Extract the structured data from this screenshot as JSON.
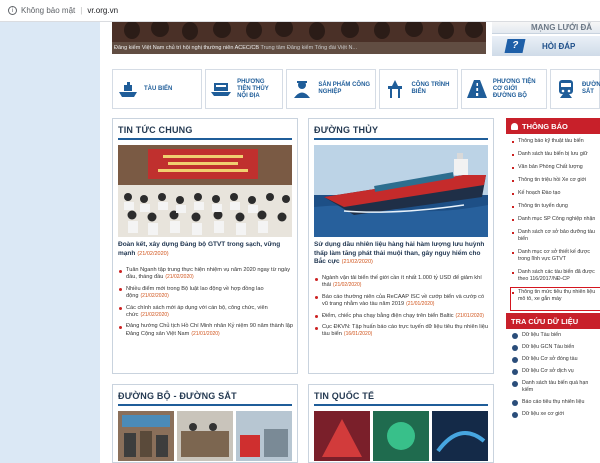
{
  "browser": {
    "security_text": "Không bảo mật",
    "url": "vr.org.vn"
  },
  "banner": {
    "caption": "Đăng kiểm Việt Nam chủ trì hội nghị thường niên ACEC/CB",
    "caption_org": "Trung tâm Đăng kiểm Tổng đài Việt N..."
  },
  "promo": {
    "top_label": "MẠNG LƯỚI ĐĂ",
    "faq_label": "HỎI ĐÁP"
  },
  "categories": [
    {
      "label": "TÀU BIỂN",
      "icon": "ship-icon"
    },
    {
      "label": "PHƯƠNG TIỆN THỦY NỘI ĐỊA",
      "icon": "riverboat-icon"
    },
    {
      "label": "SẢN PHẨM CÔNG NGHIỆP",
      "icon": "worker-icon"
    },
    {
      "label": "CÔNG TRÌNH BIỂN",
      "icon": "offshore-rig-icon"
    },
    {
      "label": "PHƯƠNG TIỆN CƠ GIỚI ĐƯỜNG BỘ",
      "icon": "road-icon"
    },
    {
      "label": "ĐƯỜNG SẮT",
      "icon": "train-icon"
    }
  ],
  "tintuc": {
    "heading": "TIN TỨC CHUNG",
    "story_title": "Đoàn kết, xây dựng Đảng bộ GTVT trong sạch, vững mạnh",
    "story_date": "(21/02/2020)",
    "items": [
      {
        "text": "Tuân Nganh tập trung thực hiện nhiệm vụ năm 2020 ngay từ ngày đầu, tháng đầu",
        "date": "(21/02/2020)"
      },
      {
        "text": "Nhiều điểm mới trong Bộ luật lao động về hợp đồng lao động",
        "date": "(21/02/2020)"
      },
      {
        "text": "Các chính sách mới áp dụng với cán bộ, công chức, viên chức",
        "date": "(21/02/2020)"
      },
      {
        "text": "Đảng hướng Chủ tịch Hồ Chí Minh nhân Kỷ niệm 90 năm thành lập Đảng Cộng sản Việt Nam",
        "date": "(21/01/2020)"
      }
    ]
  },
  "duongthuy": {
    "heading": "ĐƯỜNG THỦY",
    "story_title": "Sử dụng dầu nhiên liệu hàng hải hàm lượng lưu huỳnh thấp làm tăng phát thải muội than, gây nguy hiểm cho Bắc cực",
    "story_date": "(21/02/2020)",
    "items": [
      {
        "text": "Ngành vận tải biển thế giới cần ít nhất 1.000 tỷ USD để giảm khí thải",
        "date": "(21/02/2020)"
      },
      {
        "text": "Báo cáo thường niên của ReCAAP ISC về cướp biển và cướp có vũ trang nhằm vào tàu năm 2019",
        "date": "(21/01/2020)"
      },
      {
        "text": "Điểm, chiếc pha chạy bằng điện chạy trên biển Baltic",
        "date": "(21/01/2020)"
      },
      {
        "text": "Cục ĐKVN: Tập huấn báo cáo trực tuyến dữ liệu tiêu thụ nhiên liệu tàu biển",
        "date": "(16/01/2020)"
      }
    ]
  },
  "duongbo": {
    "heading": "ĐƯỜNG BỘ - ĐƯỜNG SẮT"
  },
  "tinqt": {
    "heading": "TIN QUỐC TẾ"
  },
  "thongbao": {
    "heading": "THÔNG BÁO",
    "items": [
      "Thông báo kỹ thuật tàu biển",
      "Danh sách tàu biển bị lưu giữ",
      "Văn bản Phòng Chất lượng",
      "Thông tin triệu hồi Xe cơ giới",
      "Kế hoạch Đào tạo",
      "Thông tin tuyển dụng",
      "Danh mục SP Công nghiệp nhận",
      "Danh sách cơ sở bảo dưỡng tàu biển",
      "Danh mục cơ sở thiết kế được trong lĩnh vực GTVT",
      "Danh sách các tàu biển đã được theo 116/2017/NĐ-CP",
      "Thông tin mức tiêu thụ nhiên liệu mô tô, xe gắn máy"
    ]
  },
  "tracuu": {
    "heading": "TRA CỨU DỮ LIỆU",
    "items": [
      "Dữ liệu Tàu biển",
      "Dữ liệu GCN Tàu biển",
      "Dữ liệu Cơ sở đóng tàu",
      "Dữ liệu Cơ sở dịch vụ",
      "Danh sách tàu biển quá hạn kiểm",
      "Báo cáo tiêu thụ nhiên liệu",
      "Dữ liệu xe cơ giới"
    ]
  }
}
